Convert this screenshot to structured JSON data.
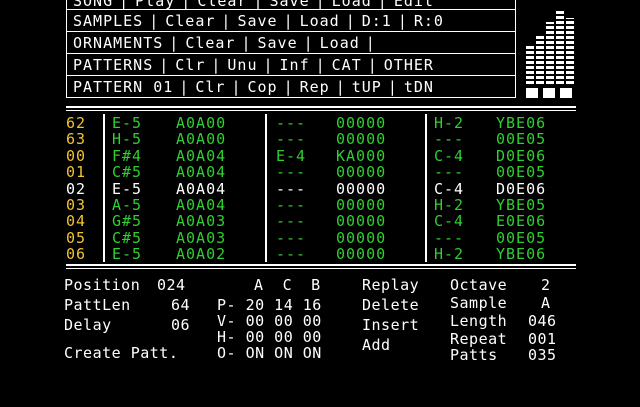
{
  "menu": [
    {
      "items": [
        "SONG",
        "Play",
        "Clear",
        "Save",
        "Load",
        "Edit"
      ]
    },
    {
      "items": [
        "SAMPLES",
        "Clear",
        "Save",
        "Load",
        "D:1",
        "R:0"
      ]
    },
    {
      "items": [
        "ORNAMENTS",
        "Clear",
        "Save",
        "Load",
        ""
      ]
    },
    {
      "items": [
        "PATTERNS",
        "Clr",
        "Unu",
        "Inf",
        "CAT",
        "OTHER"
      ]
    },
    {
      "items": [
        "PATTERN 01",
        "Clr",
        "Cop",
        "Rep",
        "tUP",
        "tDN"
      ]
    }
  ],
  "colors": {
    "accent_green": "#2fcf2f",
    "row_numbers": "#f2c230",
    "text": "#ffffff",
    "background": "#000000"
  },
  "pattern_rows": [
    {
      "n": "62",
      "c1n": "E-5",
      "c1p": "A0A00",
      "c2n": "---",
      "c2p": "00000",
      "c3n": "H-2",
      "c3p": "YBE06"
    },
    {
      "n": "63",
      "c1n": "H-5",
      "c1p": "A0A00",
      "c2n": "---",
      "c2p": "00000",
      "c3n": "---",
      "c3p": "00E05"
    },
    {
      "n": "00",
      "c1n": "F#4",
      "c1p": "A0A04",
      "c2n": "E-4",
      "c2p": "KA000",
      "c3n": "C-4",
      "c3p": "D0E06"
    },
    {
      "n": "01",
      "c1n": "C#5",
      "c1p": "A0A04",
      "c2n": "---",
      "c2p": "00000",
      "c3n": "---",
      "c3p": "00E05"
    },
    {
      "n": "02",
      "c1n": "E-5",
      "c1p": "A0A04",
      "c2n": "---",
      "c2p": "00000",
      "c3n": "C-4",
      "c3p": "D0E06"
    },
    {
      "n": "03",
      "c1n": "A-5",
      "c1p": "A0A04",
      "c2n": "---",
      "c2p": "00000",
      "c3n": "H-2",
      "c3p": "YBE05"
    },
    {
      "n": "04",
      "c1n": "G#5",
      "c1p": "A0A03",
      "c2n": "---",
      "c2p": "00000",
      "c3n": "C-4",
      "c3p": "E0E06"
    },
    {
      "n": "05",
      "c1n": "C#5",
      "c1p": "A0A03",
      "c2n": "---",
      "c2p": "00000",
      "c3n": "---",
      "c3p": "00E05"
    },
    {
      "n": "06",
      "c1n": "E-5",
      "c1p": "A0A02",
      "c2n": "---",
      "c2p": "00000",
      "c3n": "H-2",
      "c3p": "YBE06"
    }
  ],
  "status": {
    "position_label": "Position",
    "position_value": "024",
    "pattlen_label": "PattLen",
    "pattlen_value": "64",
    "delay_label": "Delay",
    "delay_value": "06",
    "create_label": "Create Patt.",
    "chan_header": "A  C  B",
    "p_row": "P- 20 14 16",
    "v_row": "V- 00 00 00",
    "h_row": "H- 00 00 00",
    "o_row": "O- ON ON ON",
    "replay": "Replay",
    "delete": "Delete",
    "insert": "Insert",
    "add": "Add",
    "octave_label": "Octave",
    "octave_value": "2",
    "sample_label": "Sample",
    "sample_value": "A",
    "length_label": "Length",
    "length_value": "046",
    "repeat_label": "Repeat",
    "repeat_value": "001",
    "patts_label": "Patts",
    "patts_value": "035"
  }
}
